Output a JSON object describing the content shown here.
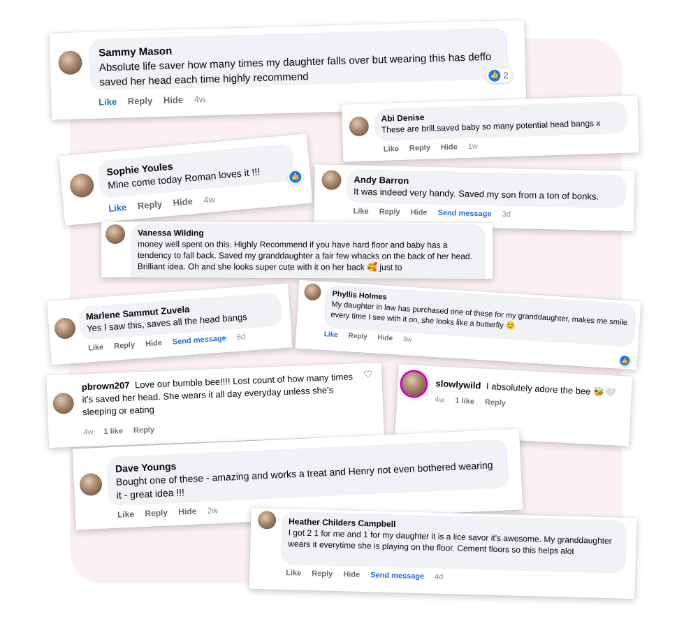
{
  "comments": [
    {
      "name": "Sammy Mason",
      "text": "Absolute life saver how many times my daughter falls over but wearing this has deffo saved her head each time highly recommend",
      "actions": [
        "Like",
        "Reply",
        "Hide"
      ],
      "time": "4w",
      "reactions": "2"
    },
    {
      "name": "Abi Denise",
      "text": "These are brill.saved baby so many potential head bangs x",
      "actions": [
        "Like",
        "Reply",
        "Hide"
      ],
      "time": "1w"
    },
    {
      "name": "Sophie Youles",
      "text": "Mine come today Roman loves it !!!",
      "actions": [
        "Like",
        "Reply",
        "Hide"
      ],
      "time": "4w"
    },
    {
      "name": "Andy Barron",
      "text": "It was indeed very handy. Saved my son from a ton of bonks.",
      "actions": [
        "Like",
        "Reply",
        "Hide"
      ],
      "send": "Send message",
      "time": "3d"
    },
    {
      "name": "Vanessa Wilding",
      "text": "money well spent on this. Highly Recommend if you have hard floor and baby has a tendency to fall back. Saved my granddaughter a fair few whacks on the back of her head. Brilliant idea. Oh and she looks super cute with it on her back 🥰 just to"
    },
    {
      "name": "Marlene Sammut Zuvela",
      "text": "Yes I saw this, saves all the head bangs",
      "actions": [
        "Like",
        "Reply",
        "Hide"
      ],
      "send": "Send message",
      "time": "6d"
    },
    {
      "name": "Phyllis Holmes",
      "text": "My daughter in law has purchased one of these for my granddaughter, makes me smile every time I see with it on, she looks like a butterfly 😊",
      "actions": [
        "Like",
        "Reply",
        "Hide"
      ],
      "time": "3w"
    },
    {
      "name": "pbrown207",
      "text": "Love our bumble bee!!!! Lost count of how many times it's saved her head. She wears it all day everyday unless she's sleeping or eating",
      "time": "4w",
      "likes": "1 like",
      "reply": "Reply"
    },
    {
      "name": "slowlywild",
      "text": "I absolutely adore the bee 🐝🤍",
      "time": "4w",
      "likes": "1 like",
      "reply": "Reply"
    },
    {
      "name": "Dave Youngs",
      "text": "Bought one of these - amazing and works a treat and Henry not even bothered wearing it - great idea !!!",
      "actions": [
        "Like",
        "Reply",
        "Hide"
      ],
      "time": "2w"
    },
    {
      "name": "Heather Childers Campbell",
      "text": "I got 2 1 for me and 1 for my daughter it is a lice savor it's awesome. My granddaughter wears it everytime she is playing on the floor. Cement floors so this helps alot",
      "actions": [
        "Like",
        "Reply",
        "Hide"
      ],
      "send": "Send message",
      "time": "4d"
    }
  ]
}
